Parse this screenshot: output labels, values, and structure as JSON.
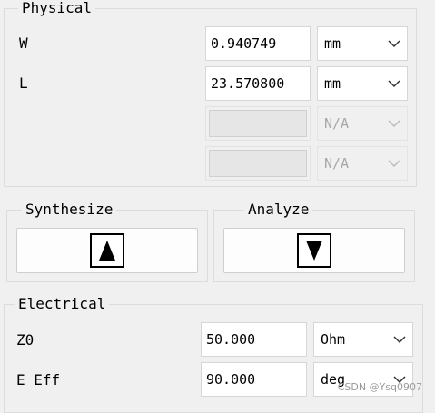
{
  "physical": {
    "title": "Physical",
    "rows": [
      {
        "label": "W",
        "value": "0.940749",
        "unit": "mm"
      },
      {
        "label": "L",
        "value": "23.570800",
        "unit": "mm"
      },
      {
        "label": "",
        "value": "",
        "unit": "N/A"
      },
      {
        "label": "",
        "value": "",
        "unit": "N/A"
      }
    ]
  },
  "synthesize": {
    "title": "Synthesize",
    "icon": "triangle-up-icon"
  },
  "analyze": {
    "title": "Analyze",
    "icon": "triangle-down-icon"
  },
  "electrical": {
    "title": "Electrical",
    "rows": [
      {
        "label": "Z0",
        "value": "50.000",
        "unit": "Ohm"
      },
      {
        "label": "E_Eff",
        "value": "90.000",
        "unit": "deg"
      }
    ]
  },
  "watermark": "CSDN @Ysq0907"
}
